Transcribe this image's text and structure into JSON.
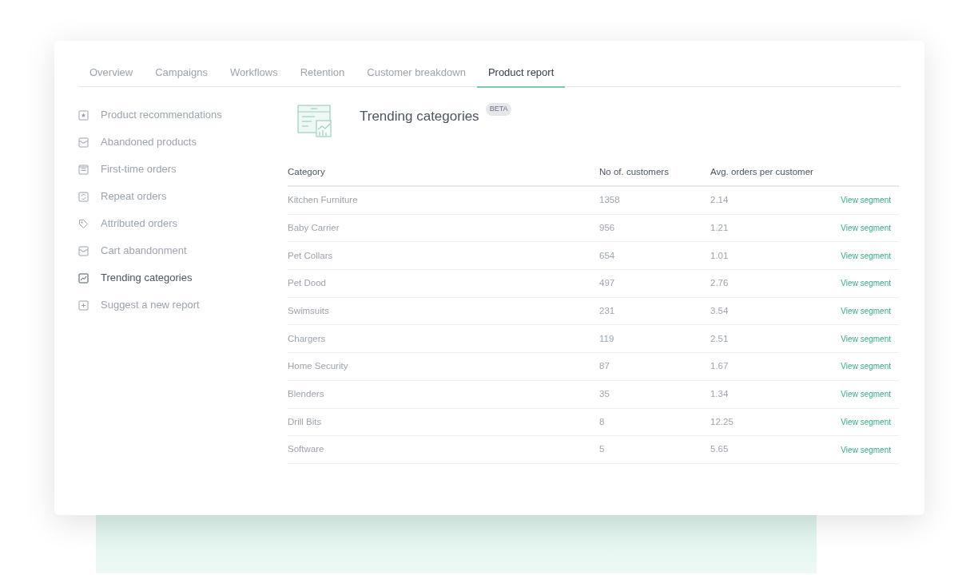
{
  "tabs": [
    {
      "label": "Overview",
      "selected": false
    },
    {
      "label": "Campaigns",
      "selected": false
    },
    {
      "label": "Workflows",
      "selected": false
    },
    {
      "label": "Retention",
      "selected": false
    },
    {
      "label": "Customer breakdown",
      "selected": false
    },
    {
      "label": "Product report",
      "selected": true
    }
  ],
  "sidebar": {
    "items": [
      {
        "label": "Product recommendations",
        "kind": "star",
        "selected": false
      },
      {
        "label": "Abandoned products",
        "kind": "inbox",
        "selected": false
      },
      {
        "label": "First-time orders",
        "kind": "list",
        "selected": false
      },
      {
        "label": "Repeat orders",
        "kind": "repeat",
        "selected": false
      },
      {
        "label": "Attributed orders",
        "kind": "tag",
        "selected": false
      },
      {
        "label": "Cart abandonment",
        "kind": "inbox",
        "selected": false
      },
      {
        "label": "Trending categories",
        "kind": "chart",
        "selected": true
      },
      {
        "label": "Suggest a new report",
        "kind": "plus",
        "selected": false
      }
    ]
  },
  "report": {
    "title": "Trending categories",
    "badge": "BETA"
  },
  "table": {
    "columns": [
      "Category",
      "No of. customers",
      "Avg. orders per customer"
    ],
    "rows": [
      [
        "Kitchen Furniture",
        "1358",
        "2.14",
        "View segment"
      ],
      [
        "Baby Carrier",
        "956",
        "1.21",
        "View segment"
      ],
      [
        "Pet Collars",
        "654",
        "1.01",
        "View segment"
      ],
      [
        "Pet Dood",
        "497",
        "2.76",
        "View segment"
      ],
      [
        "Swimsuits",
        "231",
        "3.54",
        "View segment"
      ],
      [
        "Chargers",
        "119",
        "2.51",
        "View segment"
      ],
      [
        "Home Security",
        "87",
        "1.67",
        "View segment"
      ],
      [
        "Blenders",
        "35",
        "1.34",
        "View segment"
      ],
      [
        "Drill Bits",
        "8",
        "12.25",
        "View segment"
      ],
      [
        "Software",
        "5",
        "5.65",
        "View segment"
      ]
    ]
  }
}
